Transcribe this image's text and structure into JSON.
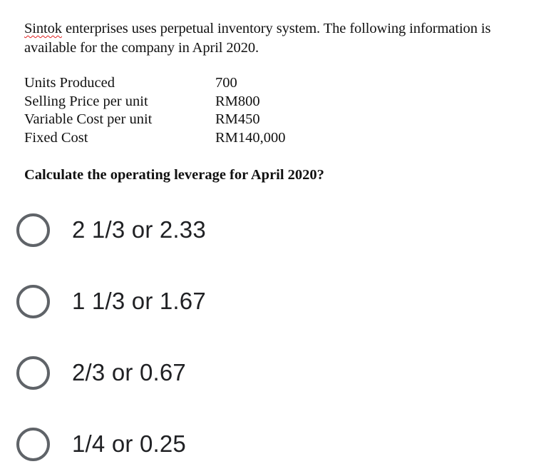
{
  "question": {
    "intro_company": "Sintok",
    "intro_rest_line1": " enterprises uses perpetual inventory system. The following information is",
    "intro_line2": "available for the company in April 2020.",
    "info": [
      {
        "label": "Units Produced",
        "value": "700"
      },
      {
        "label": "Selling Price per unit",
        "value": "RM800"
      },
      {
        "label": "Variable Cost per unit",
        "value": "RM450"
      },
      {
        "label": "Fixed Cost",
        "value": "RM140,000"
      }
    ],
    "prompt": "Calculate the operating leverage for April 2020?"
  },
  "options": [
    {
      "label": "2 1/3 or 2.33",
      "selected": false
    },
    {
      "label": "1 1/3 or 1.67",
      "selected": false
    },
    {
      "label": "2/3 or 0.67",
      "selected": false
    },
    {
      "label": "1/4 or 0.25",
      "selected": false
    }
  ],
  "colors": {
    "radio_border": "#5f6368",
    "option_text": "#202124",
    "spellcheck_underline": "#e02020"
  }
}
